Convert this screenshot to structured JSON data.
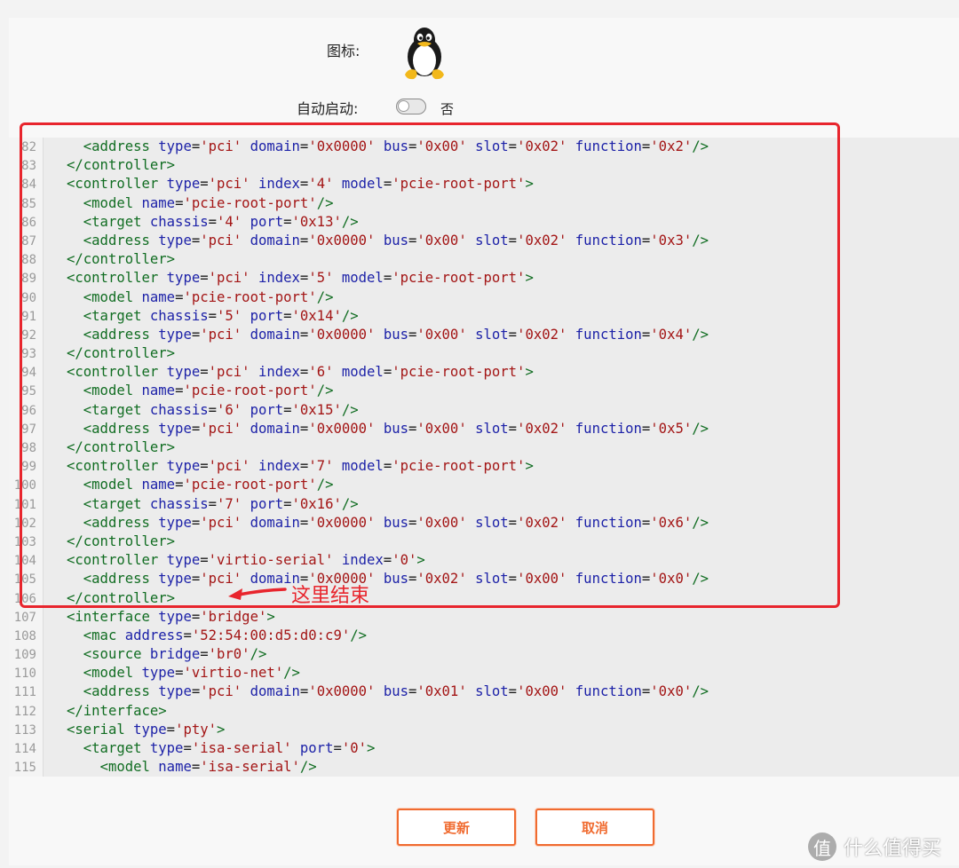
{
  "form": {
    "icon_label": "图标:",
    "autostart_label": "自动启动:",
    "autostart_state": "否",
    "autostart_on": false
  },
  "icons": {
    "os_icon": "linux-tux-icon",
    "watermark_icon": "smzdm-logo-icon"
  },
  "colors": {
    "accent": "#f06b30",
    "highlight": "#e8252d",
    "xml_tag": "#116d22",
    "xml_attribute": "#1d22a8",
    "xml_value": "#a31515"
  },
  "editor": {
    "lines": [
      {
        "n": "82",
        "indent": 2,
        "tag": "address",
        "attrs": [
          [
            "type",
            "pci"
          ],
          [
            "domain",
            "0x0000"
          ],
          [
            "bus",
            "0x00"
          ],
          [
            "slot",
            "0x02"
          ],
          [
            "function",
            "0x2"
          ]
        ],
        "end": "/>"
      },
      {
        "n": "83",
        "indent": 1,
        "close": "controller"
      },
      {
        "n": "84",
        "indent": 1,
        "tag": "controller",
        "attrs": [
          [
            "type",
            "pci"
          ],
          [
            "index",
            "4"
          ],
          [
            "model",
            "pcie-root-port"
          ]
        ],
        "end": ">"
      },
      {
        "n": "85",
        "indent": 2,
        "tag": "model",
        "attrs": [
          [
            "name",
            "pcie-root-port"
          ]
        ],
        "end": "/>"
      },
      {
        "n": "86",
        "indent": 2,
        "tag": "target",
        "attrs": [
          [
            "chassis",
            "4"
          ],
          [
            "port",
            "0x13"
          ]
        ],
        "end": "/>"
      },
      {
        "n": "87",
        "indent": 2,
        "tag": "address",
        "attrs": [
          [
            "type",
            "pci"
          ],
          [
            "domain",
            "0x0000"
          ],
          [
            "bus",
            "0x00"
          ],
          [
            "slot",
            "0x02"
          ],
          [
            "function",
            "0x3"
          ]
        ],
        "end": "/>"
      },
      {
        "n": "88",
        "indent": 1,
        "close": "controller"
      },
      {
        "n": "89",
        "indent": 1,
        "tag": "controller",
        "attrs": [
          [
            "type",
            "pci"
          ],
          [
            "index",
            "5"
          ],
          [
            "model",
            "pcie-root-port"
          ]
        ],
        "end": ">"
      },
      {
        "n": "90",
        "indent": 2,
        "tag": "model",
        "attrs": [
          [
            "name",
            "pcie-root-port"
          ]
        ],
        "end": "/>"
      },
      {
        "n": "91",
        "indent": 2,
        "tag": "target",
        "attrs": [
          [
            "chassis",
            "5"
          ],
          [
            "port",
            "0x14"
          ]
        ],
        "end": "/>"
      },
      {
        "n": "92",
        "indent": 2,
        "tag": "address",
        "attrs": [
          [
            "type",
            "pci"
          ],
          [
            "domain",
            "0x0000"
          ],
          [
            "bus",
            "0x00"
          ],
          [
            "slot",
            "0x02"
          ],
          [
            "function",
            "0x4"
          ]
        ],
        "end": "/>"
      },
      {
        "n": "93",
        "indent": 1,
        "close": "controller"
      },
      {
        "n": "94",
        "indent": 1,
        "tag": "controller",
        "attrs": [
          [
            "type",
            "pci"
          ],
          [
            "index",
            "6"
          ],
          [
            "model",
            "pcie-root-port"
          ]
        ],
        "end": ">"
      },
      {
        "n": "95",
        "indent": 2,
        "tag": "model",
        "attrs": [
          [
            "name",
            "pcie-root-port"
          ]
        ],
        "end": "/>"
      },
      {
        "n": "96",
        "indent": 2,
        "tag": "target",
        "attrs": [
          [
            "chassis",
            "6"
          ],
          [
            "port",
            "0x15"
          ]
        ],
        "end": "/>"
      },
      {
        "n": "97",
        "indent": 2,
        "tag": "address",
        "attrs": [
          [
            "type",
            "pci"
          ],
          [
            "domain",
            "0x0000"
          ],
          [
            "bus",
            "0x00"
          ],
          [
            "slot",
            "0x02"
          ],
          [
            "function",
            "0x5"
          ]
        ],
        "end": "/>"
      },
      {
        "n": "98",
        "indent": 1,
        "close": "controller"
      },
      {
        "n": "99",
        "indent": 1,
        "tag": "controller",
        "attrs": [
          [
            "type",
            "pci"
          ],
          [
            "index",
            "7"
          ],
          [
            "model",
            "pcie-root-port"
          ]
        ],
        "end": ">"
      },
      {
        "n": "100",
        "indent": 2,
        "tag": "model",
        "attrs": [
          [
            "name",
            "pcie-root-port"
          ]
        ],
        "end": "/>"
      },
      {
        "n": "101",
        "indent": 2,
        "tag": "target",
        "attrs": [
          [
            "chassis",
            "7"
          ],
          [
            "port",
            "0x16"
          ]
        ],
        "end": "/>"
      },
      {
        "n": "102",
        "indent": 2,
        "tag": "address",
        "attrs": [
          [
            "type",
            "pci"
          ],
          [
            "domain",
            "0x0000"
          ],
          [
            "bus",
            "0x00"
          ],
          [
            "slot",
            "0x02"
          ],
          [
            "function",
            "0x6"
          ]
        ],
        "end": "/>"
      },
      {
        "n": "103",
        "indent": 1,
        "close": "controller"
      },
      {
        "n": "104",
        "indent": 1,
        "tag": "controller",
        "attrs": [
          [
            "type",
            "virtio-serial"
          ],
          [
            "index",
            "0"
          ]
        ],
        "end": ">"
      },
      {
        "n": "105",
        "indent": 2,
        "tag": "address",
        "attrs": [
          [
            "type",
            "pci"
          ],
          [
            "domain",
            "0x0000"
          ],
          [
            "bus",
            "0x02"
          ],
          [
            "slot",
            "0x00"
          ],
          [
            "function",
            "0x0"
          ]
        ],
        "end": "/>"
      },
      {
        "n": "106",
        "indent": 1,
        "close": "controller"
      },
      {
        "n": "107",
        "indent": 1,
        "tag": "interface",
        "attrs": [
          [
            "type",
            "bridge"
          ]
        ],
        "end": ">"
      },
      {
        "n": "108",
        "indent": 2,
        "tag": "mac",
        "attrs": [
          [
            "address",
            "52:54:00:d5:d0:c9"
          ]
        ],
        "end": "/>"
      },
      {
        "n": "109",
        "indent": 2,
        "tag": "source",
        "attrs": [
          [
            "bridge",
            "br0"
          ]
        ],
        "end": "/>"
      },
      {
        "n": "110",
        "indent": 2,
        "tag": "model",
        "attrs": [
          [
            "type",
            "virtio-net"
          ]
        ],
        "end": "/>"
      },
      {
        "n": "111",
        "indent": 2,
        "tag": "address",
        "attrs": [
          [
            "type",
            "pci"
          ],
          [
            "domain",
            "0x0000"
          ],
          [
            "bus",
            "0x01"
          ],
          [
            "slot",
            "0x00"
          ],
          [
            "function",
            "0x0"
          ]
        ],
        "end": "/>"
      },
      {
        "n": "112",
        "indent": 1,
        "close": "interface"
      },
      {
        "n": "113",
        "indent": 1,
        "tag": "serial",
        "attrs": [
          [
            "type",
            "pty"
          ]
        ],
        "end": ">"
      },
      {
        "n": "114",
        "indent": 2,
        "tag": "target",
        "attrs": [
          [
            "type",
            "isa-serial"
          ],
          [
            "port",
            "0"
          ]
        ],
        "end": ">"
      },
      {
        "n": "115",
        "indent": 3,
        "tag": "model",
        "attrs": [
          [
            "name",
            "isa-serial"
          ]
        ],
        "end": "/>"
      }
    ]
  },
  "annotation": {
    "text": "这里结束"
  },
  "buttons": {
    "update": "更新",
    "cancel": "取消"
  },
  "watermark": {
    "text": "什么值得买",
    "logo": "值"
  }
}
